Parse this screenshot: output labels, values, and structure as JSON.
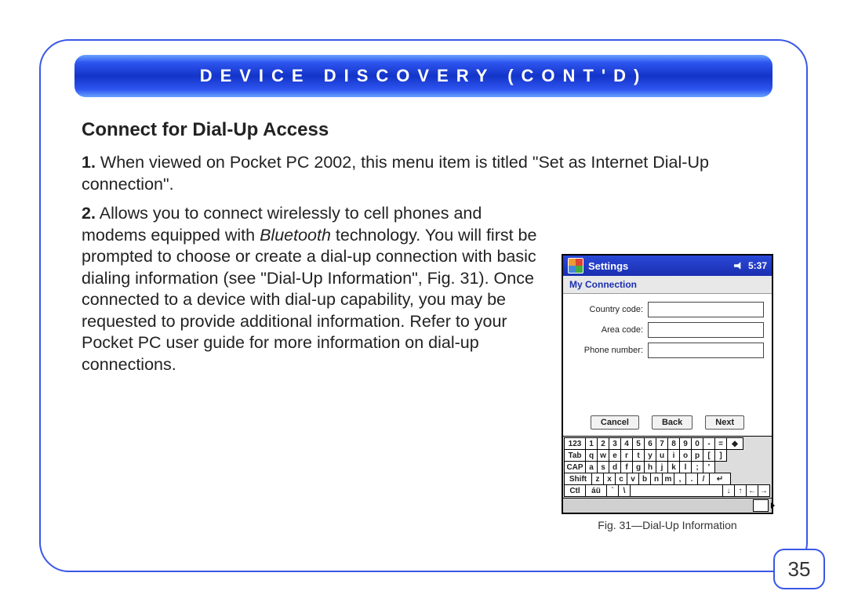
{
  "banner": {
    "title": "DEVICE DISCOVERY (CONT'D)"
  },
  "subhead": "Connect for Dial-Up Access",
  "paragraphs": {
    "p1": {
      "num": "1.",
      "text": " When viewed on Pocket PC 2002, this menu item is titled \"Set as Internet Dial-Up connection\"."
    },
    "p2": {
      "num": "2.",
      "lead": " Allows you to connect wirelessly to cell phones and modems equipped with ",
      "em": "Bluetooth",
      "tail": " technology. You will first be prompted to choose or create a dial-up connection with basic dialing information (see \"Dial-Up Information\", Fig. 31). Once connected to a device with dial-up capability, you may be requested to provide additional information. Refer to your Pocket PC user guide for more information on dial-up connections."
    }
  },
  "figure": {
    "caption": "Fig. 31—Dial-Up Information",
    "titlebar": {
      "app": "Settings",
      "time": "5:37"
    },
    "subtitle": "My Connection",
    "fields": {
      "country": "Country code:",
      "area": "Area code:",
      "phone": "Phone number:"
    },
    "buttons": {
      "cancel": "Cancel",
      "back": "Back",
      "next": "Next"
    },
    "keyboard": {
      "row1": [
        "123",
        "1",
        "2",
        "3",
        "4",
        "5",
        "6",
        "7",
        "8",
        "9",
        "0",
        "-",
        "=",
        "◆"
      ],
      "row2": [
        "Tab",
        "q",
        "w",
        "e",
        "r",
        "t",
        "y",
        "u",
        "i",
        "o",
        "p",
        "[",
        "]"
      ],
      "row3": [
        "CAP",
        "a",
        "s",
        "d",
        "f",
        "g",
        "h",
        "j",
        "k",
        "l",
        ";",
        "'"
      ],
      "row4": [
        "Shift",
        "z",
        "x",
        "c",
        "v",
        "b",
        "n",
        "m",
        ",",
        ".",
        "/",
        "↵"
      ],
      "row5": [
        "Ctl",
        "áü",
        "`",
        "\\",
        " ",
        "↓",
        "↑",
        "←",
        "→"
      ]
    }
  },
  "page_number": "35"
}
